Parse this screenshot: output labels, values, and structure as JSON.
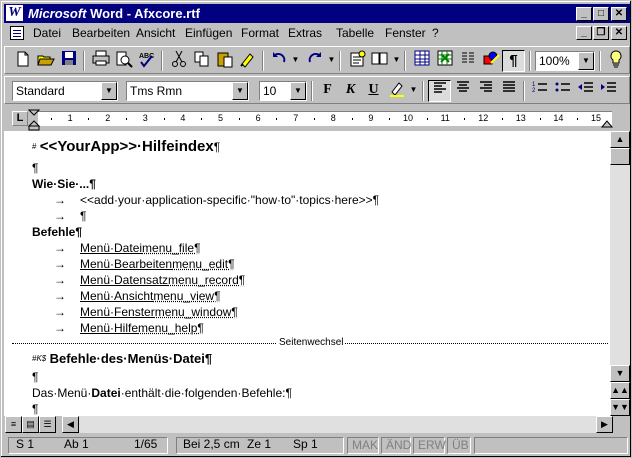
{
  "window": {
    "brand": "Microsoft",
    "title_rest": " Word - Afxcore.rtf",
    "logo": "W",
    "controls": {
      "minimize": "_",
      "maximize": "□",
      "close": "✕"
    }
  },
  "menu": {
    "items": [
      "Datei",
      "Bearbeiten",
      "Ansicht",
      "Einfügen",
      "Format",
      "Extras",
      "Tabelle",
      "Fenster",
      "?"
    ],
    "doc_controls": {
      "minimize": "_",
      "restore": "❐",
      "close": "✕"
    }
  },
  "standard_toolbar": {
    "icons": [
      "new-document-icon",
      "open-folder-icon",
      "save-icon",
      "print-icon",
      "print-preview-icon",
      "spellcheck-icon",
      "cut-icon",
      "copy-icon",
      "paste-icon",
      "format-painter-icon",
      "undo-icon",
      "redo-icon",
      "autotext-icon",
      "insert-address-icon",
      "insert-table-icon",
      "insert-excel-icon",
      "columns-icon",
      "drawing-icon",
      "show-formatting-icon",
      "tip-wizard-icon"
    ],
    "zoom": "100%"
  },
  "format_toolbar": {
    "style": "Standard",
    "font": "Tms Rmn",
    "size": "10",
    "bold": "F",
    "italic": "K",
    "underline": "U"
  },
  "ruler": {
    "numbers": [
      "1",
      "2",
      "3",
      "4",
      "5",
      "6",
      "7",
      "8",
      "9",
      "10",
      "11",
      "12",
      "13",
      "14",
      "15"
    ]
  },
  "document": {
    "heading": "<<YourApp>>·Hilfeindex",
    "heading_mark": "#",
    "pilcrow": "¶",
    "how_to_title": "Wie·Sie·...¶",
    "how_to_item1": "<<add·your·application-specific·\"how·to\"·topics·here>>¶",
    "how_to_item2": "¶",
    "commands_title": "Befehle¶",
    "arrow": "→",
    "commands": [
      {
        "link": "Menü·Datei",
        "target": "menu_file¶"
      },
      {
        "link": "Menü·Bearbeiten",
        "target": "menu_edit¶"
      },
      {
        "link": "Menü·Datensatz",
        "target": "menu_record¶"
      },
      {
        "link": "Menü·Ansicht",
        "target": "menu_view¶"
      },
      {
        "link": "Menü·Fenster",
        "target": "menu_window¶"
      },
      {
        "link": "Menü·Hilfe",
        "target": "menu_help¶"
      }
    ],
    "page_break": "Seitenwechsel",
    "section2_mark": "#K$",
    "section2_title": "Befehle·des·Menüs·Datei¶",
    "para_empty": "¶",
    "intro_pre": "Das·Menü·",
    "intro_bold": "Datei",
    "intro_post": "·enthält·die·folgenden·Befehle:¶",
    "para_empty2": "¶"
  },
  "status": {
    "section": "S 1",
    "page": "Ab 1",
    "pages": "1/65",
    "position": "Bei 2,5 cm",
    "line": "Ze 1",
    "column": "Sp 1",
    "mak": "MAK",
    "and": "ÄND",
    "erw": "ERW",
    "ub": "ÜB"
  }
}
